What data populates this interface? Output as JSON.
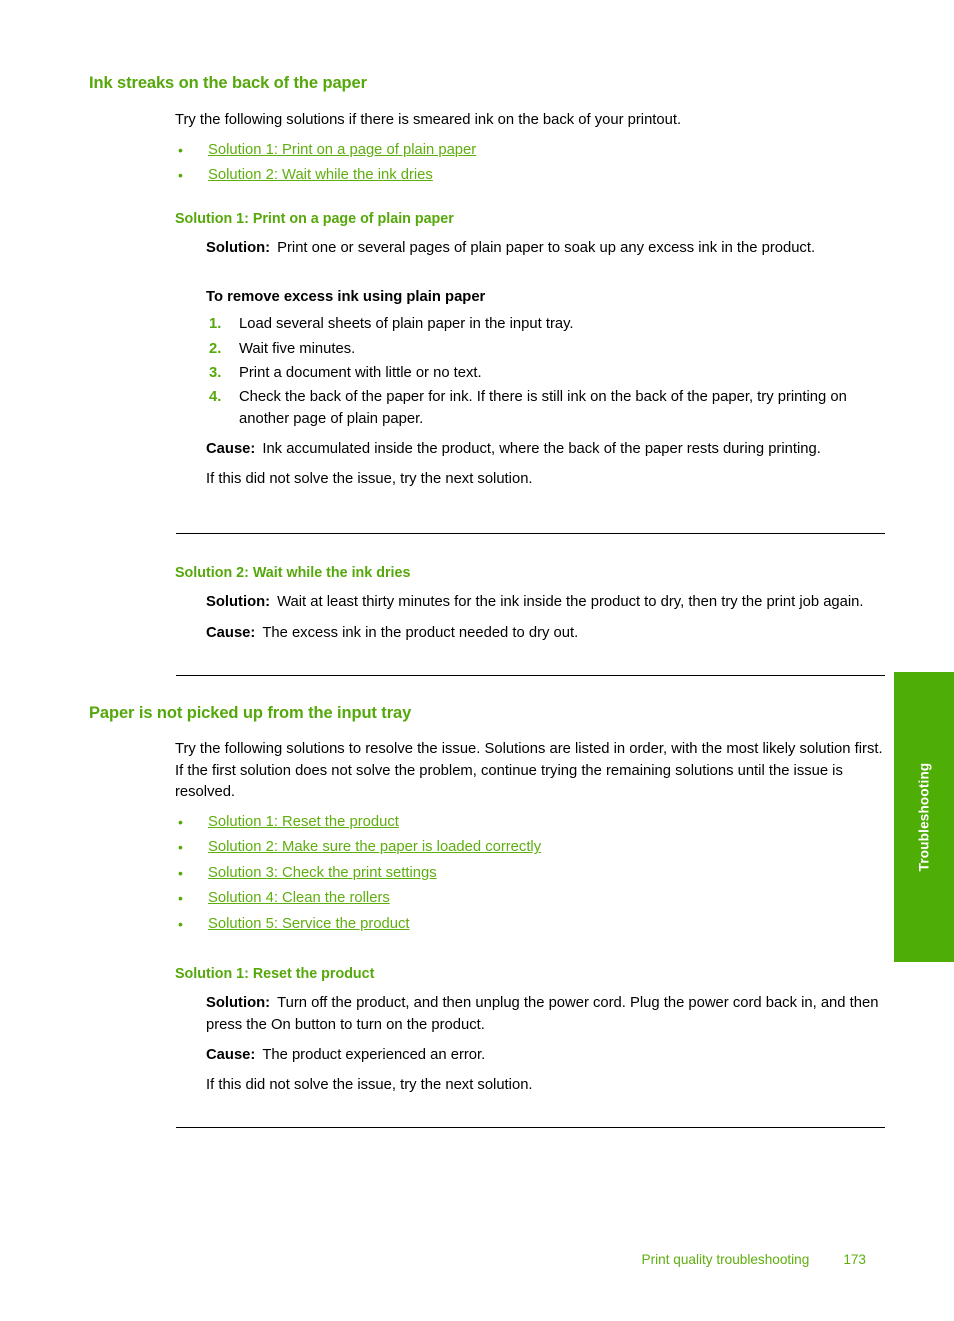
{
  "colors": {
    "heading_green": "#55A80B",
    "link_green": "#5FAE10",
    "tab_green": "#4FAE06",
    "body_black": "#000000"
  },
  "side_tab": {
    "label": "Troubleshooting"
  },
  "sections": [
    {
      "title": "Ink streaks on the back of the paper",
      "intro": "Try the following solutions if there is smeared ink on the back of your printout.",
      "links": [
        "Solution 1: Print on a page of plain paper",
        "Solution 2: Wait while the ink dries"
      ],
      "solutions": [
        {
          "heading": "Solution 1: Print on a page of plain paper",
          "solution_label": "Solution:",
          "solution_text": "Print one or several pages of plain paper to soak up any excess ink in the product.",
          "procedure_title": "To remove excess ink using plain paper",
          "steps": [
            "Load several sheets of plain paper in the input tray.",
            "Wait five minutes.",
            "Print a document with little or no text.",
            "Check the back of the paper for ink. If there is still ink on the back of the paper, try printing on another page of plain paper."
          ],
          "cause_label": "Cause:",
          "cause_text": "Ink accumulated inside the product, where the back of the paper rests during printing.",
          "next": "If this did not solve the issue, try the next solution."
        },
        {
          "heading": "Solution 2: Wait while the ink dries",
          "solution_label": "Solution:",
          "solution_text": "Wait at least thirty minutes for the ink inside the product to dry, then try the print job again.",
          "cause_label": "Cause:",
          "cause_text": "The excess ink in the product needed to dry out."
        }
      ]
    },
    {
      "title": "Paper is not picked up from the input tray",
      "intro": "Try the following solutions to resolve the issue. Solutions are listed in order, with the most likely solution first. If the first solution does not solve the problem, continue trying the remaining solutions until the issue is resolved.",
      "links": [
        "Solution 1: Reset the product",
        "Solution 2: Make sure the paper is loaded correctly",
        "Solution 3: Check the print settings",
        "Solution 4: Clean the rollers",
        "Solution 5: Service the product"
      ],
      "solutions": [
        {
          "heading": "Solution 1: Reset the product",
          "solution_label": "Solution:",
          "solution_text": "Turn off the product, and then unplug the power cord. Plug the power cord back in, and then press the On button to turn on the product.",
          "cause_label": "Cause:",
          "cause_text": "The product experienced an error.",
          "next": "If this did not solve the issue, try the next solution."
        }
      ]
    }
  ],
  "footer": {
    "chapter": "Print quality troubleshooting",
    "page_number": "173"
  },
  "bullet_glyph": "•"
}
